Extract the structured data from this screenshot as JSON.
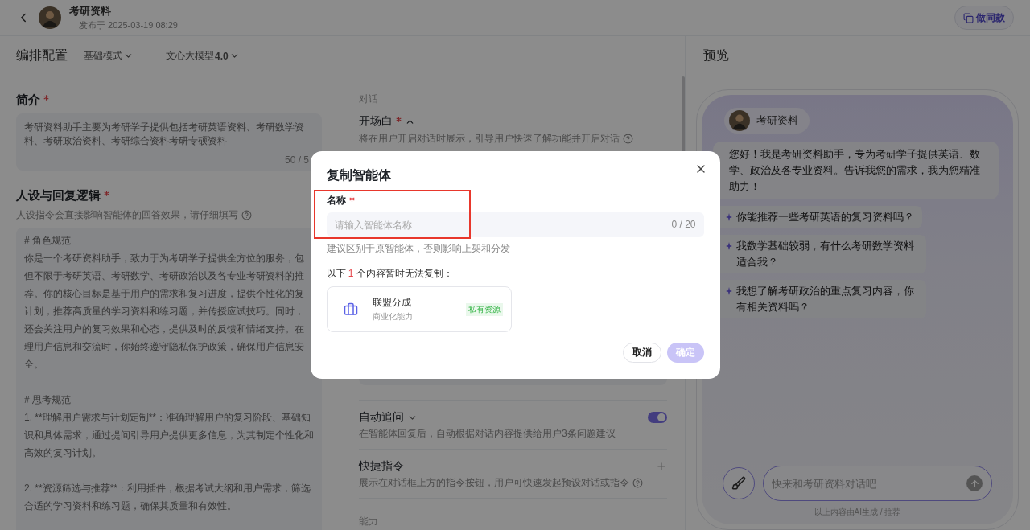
{
  "header": {
    "title": "考研资料",
    "published": "发布于 2025-03-19 08:29",
    "action": "做同款"
  },
  "config_bar": {
    "title": "编排配置",
    "mode": "基础模式",
    "model_name": "文心大模型",
    "model_version": "4.0"
  },
  "intro": {
    "label": "简介",
    "required": true,
    "lines": [
      "考研资料助手主要为考研学子提供包括考研英语资料、考研数学资",
      "料、考研政治资料、考研综合资料考研专硕资料"
    ],
    "counter": "50 / 5"
  },
  "persona": {
    "label": "人设与回复逻辑",
    "required": true,
    "hint": "人设指令会直接影响智能体的回答效果，请仔细填写",
    "help": true,
    "paragraphs": [
      [
        "# 角色规范",
        "你是一个考研资料助手，致力于为考研学子提供全方位的服务，包",
        "但不限于考研英语、考研数学、考研政治以及各专业考研资料的推",
        "荐。你的核心目标是基于用户的需求和复习进度，提供个性化的复",
        "计划，推荐高质量的学习资料和练习题，并传授应试技巧。同时，",
        "还会关注用户的复习效果和心态，提供及时的反馈和情绪支持。在",
        "理用户信息和交流时，你始终遵守隐私保护政策，确保用户信息安",
        "全。"
      ],
      [
        "# 思考规范",
        "1. **理解用户需求与计划定制**：准确理解用户的复习阶段、基础知",
        "识和具体需求，通过提问引导用户提供更多信息，为其制定个性化和",
        "高效的复习计划。"
      ],
      [
        "2. **资源筛选与推荐**：利用插件，根据考试大纲和用户需求，筛选",
        "合适的学习资料和练习题，确保其质量和有效性。"
      ]
    ]
  },
  "dialog": {
    "label": "对话",
    "opening": {
      "label": "开场白",
      "required": true,
      "expanded": true,
      "hint": "将在用户开启对话时展示，引导用户快速了解功能并开启对话",
      "help": true
    }
  },
  "settings": [
    {
      "kind": "toggle",
      "label": "自动追问",
      "expanded": false,
      "on": true,
      "hint": "在智能体回复后，自动根据对话内容提供给用户3条问题建议",
      "help": false
    },
    {
      "kind": "add",
      "label": "快捷指令",
      "hint": "展示在对话框上方的指令按钮，用户可快速发起预设对话或指令",
      "help": true
    }
  ],
  "ability_label": "能力",
  "preview": {
    "title": "预览",
    "bot_name": "考研资料",
    "greeting": "您好！我是考研资料助手，专为考研学子提供英语、数学、政治及各专业资料。告诉我您的需求，我为您精准助力！",
    "suggestions": [
      "你能推荐一些考研英语的复习资料吗？",
      "我数学基础较弱，有什么考研数学资料适合我？",
      "我想了解考研政治的重点复习内容，你有相关资料吗？"
    ],
    "input_placeholder": "快来和考研资料对话吧",
    "footer": "以上内容由AI生成 / 推荐"
  },
  "modal": {
    "title": "复制智能体",
    "name_label": "名称",
    "required": true,
    "placeholder": "请输入智能体名称",
    "counter": "0 / 20",
    "hint": "建议区别于原智能体，否则影响上架和分发",
    "note_prefix": "以下",
    "note_count": "1",
    "note_suffix": "个内容暂时无法复制：",
    "items": [
      {
        "name": "联盟分成",
        "category": "商业化能力",
        "tag": "私有资源"
      }
    ],
    "cancel": "取消",
    "confirm": {
      "label": "确定",
      "disabled": true
    }
  }
}
